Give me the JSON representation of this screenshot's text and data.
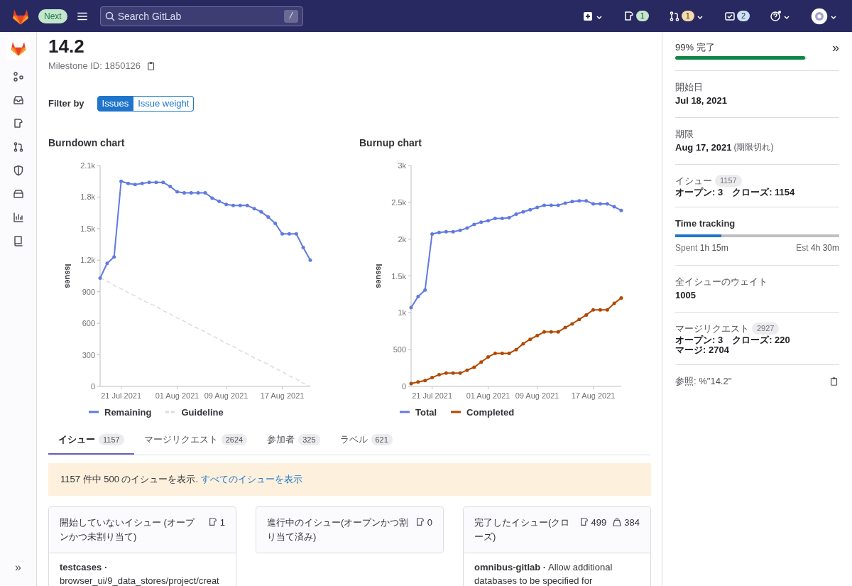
{
  "top_bar": {
    "badge": "Next",
    "search": {
      "placeholder": "Search GitLab",
      "shortcut": "/"
    },
    "counters": [
      {
        "kind": "create"
      },
      {
        "kind": "issues",
        "count": "1",
        "color": "#c3e6cd"
      },
      {
        "kind": "merge_requests",
        "count": "1",
        "color": "#f5d9a8"
      },
      {
        "kind": "todos",
        "count": "2",
        "color": "#cbe2f9"
      },
      {
        "kind": "help"
      },
      {
        "kind": "avatar"
      }
    ]
  },
  "nav": {
    "items": [
      {
        "kind": "logo"
      },
      {
        "kind": "groups"
      },
      {
        "kind": "inbox"
      },
      {
        "kind": "issue"
      },
      {
        "kind": "merge"
      },
      {
        "kind": "shield"
      },
      {
        "kind": "package"
      },
      {
        "kind": "chart"
      },
      {
        "kind": "book"
      }
    ],
    "collapse": "»"
  },
  "milestone": {
    "title": "14.2",
    "id": "Milestone ID: 1850126"
  },
  "filter": {
    "label": "Filter by",
    "options": [
      {
        "label": "Issues",
        "selected": true
      },
      {
        "label": "Issue weight",
        "selected": false
      }
    ]
  },
  "charts": [
    {
      "title": "Burndown chart",
      "chart_data": {
        "type": "line",
        "legend": true,
        "ylabel": "Issues",
        "categories": [
          null,
          null,
          null,
          "21 Jul 2021",
          null,
          null,
          null,
          null,
          null,
          null,
          null,
          "01 Aug 2021",
          null,
          null,
          null,
          null,
          null,
          null,
          "09 Aug 2021",
          null,
          null,
          null,
          null,
          null,
          null,
          null,
          "17 Aug 2021",
          null,
          null,
          null,
          null
        ],
        "ylim": [
          0,
          2100
        ],
        "yticks": [
          {
            "value": 0,
            "label": "0"
          },
          300,
          600,
          900,
          {
            "value": 1200,
            "label": "1.2k"
          },
          {
            "value": 1500,
            "label": "1.5k"
          },
          {
            "value": 1800,
            "label": "1.8k"
          },
          {
            "value": 2100,
            "label": "2.1k"
          }
        ],
        "series": [
          {
            "name": "Remaining",
            "color": "#617ae2",
            "values": [
              1030,
              1170,
              1230,
              1950,
              1930,
              1920,
              1930,
              1940,
              1940,
              1940,
              1900,
              1850,
              1840,
              1840,
              1840,
              1840,
              1790,
              1760,
              1730,
              1720,
              1720,
              1720,
              1690,
              1660,
              1610,
              1550,
              1450,
              1450,
              1450,
              1320,
              1200
            ]
          },
          {
            "name": "Guideline",
            "color": "#dcdcde",
            "line_style": "dashed",
            "values": [
              1030,
              1000,
              960,
              930,
              890,
              860,
              820,
              790,
              760,
              720,
              690,
              650,
              620,
              580,
              550,
              520,
              480,
              450,
              410,
              380,
              340,
              310,
              270,
              240,
              210,
              170,
              140,
              100,
              70,
              30,
              0
            ]
          }
        ]
      }
    },
    {
      "title": "Burnup chart",
      "chart_data": {
        "type": "line",
        "legend": true,
        "ylabel": "Issues",
        "categories": [
          null,
          null,
          null,
          "21 Jul 2021",
          null,
          null,
          null,
          null,
          null,
          null,
          null,
          "01 Aug 2021",
          null,
          null,
          null,
          null,
          null,
          null,
          "09 Aug 2021",
          null,
          null,
          null,
          null,
          null,
          null,
          null,
          "17 Aug 2021",
          null,
          null,
          null,
          null
        ],
        "ylim": [
          0,
          3000
        ],
        "yticks": [
          {
            "value": 0,
            "label": "0"
          },
          500,
          {
            "value": 1000,
            "label": "1k"
          },
          {
            "value": 1500,
            "label": "1.5k"
          },
          {
            "value": 2000,
            "label": "2k"
          },
          {
            "value": 2500,
            "label": "2.5k"
          },
          {
            "value": 3000,
            "label": "3k"
          }
        ],
        "series": [
          {
            "name": "Total",
            "color": "#617ae2",
            "values": [
              1070,
              1220,
              1310,
              2070,
              2090,
              2100,
              2100,
              2120,
              2150,
              2200,
              2230,
              2250,
              2280,
              2280,
              2290,
              2340,
              2370,
              2400,
              2430,
              2460,
              2460,
              2460,
              2490,
              2510,
              2520,
              2520,
              2480,
              2480,
              2480,
              2440,
              2390
            ]
          },
          {
            "name": "Completed",
            "color": "#b24800",
            "values": [
              40,
              60,
              80,
              120,
              160,
              180,
              180,
              180,
              220,
              260,
              330,
              400,
              450,
              450,
              450,
              500,
              580,
              640,
              690,
              740,
              740,
              740,
              800,
              850,
              910,
              970,
              1040,
              1040,
              1040,
              1130,
              1200
            ]
          }
        ]
      }
    }
  ],
  "tabs": [
    {
      "label": "イシュー",
      "count": "1157",
      "selected": true
    },
    {
      "label": "マージリクエスト",
      "count": "2624",
      "selected": false
    },
    {
      "label": "参加者",
      "count": "325",
      "selected": false
    },
    {
      "label": "ラベル",
      "count": "621",
      "selected": false
    }
  ],
  "alert": {
    "text": "1157 件中 500 のイシューを表示.",
    "link": "すべてのイシューを表示"
  },
  "boards": [
    {
      "title": "開始していないイシュー (オープンかつ未割り当て)",
      "counts": [
        {
          "kind": "issue",
          "value": "1"
        }
      ],
      "item": {
        "project": "testcases ·",
        "text": "browser_ui/9_data_stores/project/creat"
      }
    },
    {
      "title": "進行中のイシュー(オープンかつ割り当て済み)",
      "counts": [
        {
          "kind": "issue",
          "value": "0"
        }
      ]
    },
    {
      "title": "完了したイシュー(クローズ)",
      "counts": [
        {
          "kind": "issue",
          "value": "499"
        },
        {
          "kind": "weight",
          "value": "384"
        }
      ],
      "item": {
        "project": "omnibus-gitlab ·",
        "text": "Allow additional databases to be specified for"
      }
    }
  ],
  "sidebar": {
    "progress": {
      "label": "99% 完了",
      "level": 0.99
    },
    "collapse": "»",
    "start": {
      "label": "開始日",
      "value": "Jul 18, 2021"
    },
    "due": {
      "label": "期限",
      "value": "Aug 17, 2021",
      "note": "(期限切れ)"
    },
    "issues": {
      "label": "イシュー",
      "count": "1157",
      "lines": [
        "オープン: 3　クローズ: 1154"
      ]
    },
    "time": {
      "title": "Time tracking",
      "level": 0.28,
      "spent_label": "Spent",
      "spent": "1h 15m",
      "est_label": "Est",
      "est": "4h 30m"
    },
    "weight": {
      "label": "全イシューのウェイト",
      "value": "1005"
    },
    "merge_requests": {
      "label": "マージリクエスト",
      "count": "2927",
      "lines": [
        "オープン: 3　クローズ: 220",
        "マージ: 2704"
      ]
    },
    "reference": "参照: %\"14.2\""
  }
}
